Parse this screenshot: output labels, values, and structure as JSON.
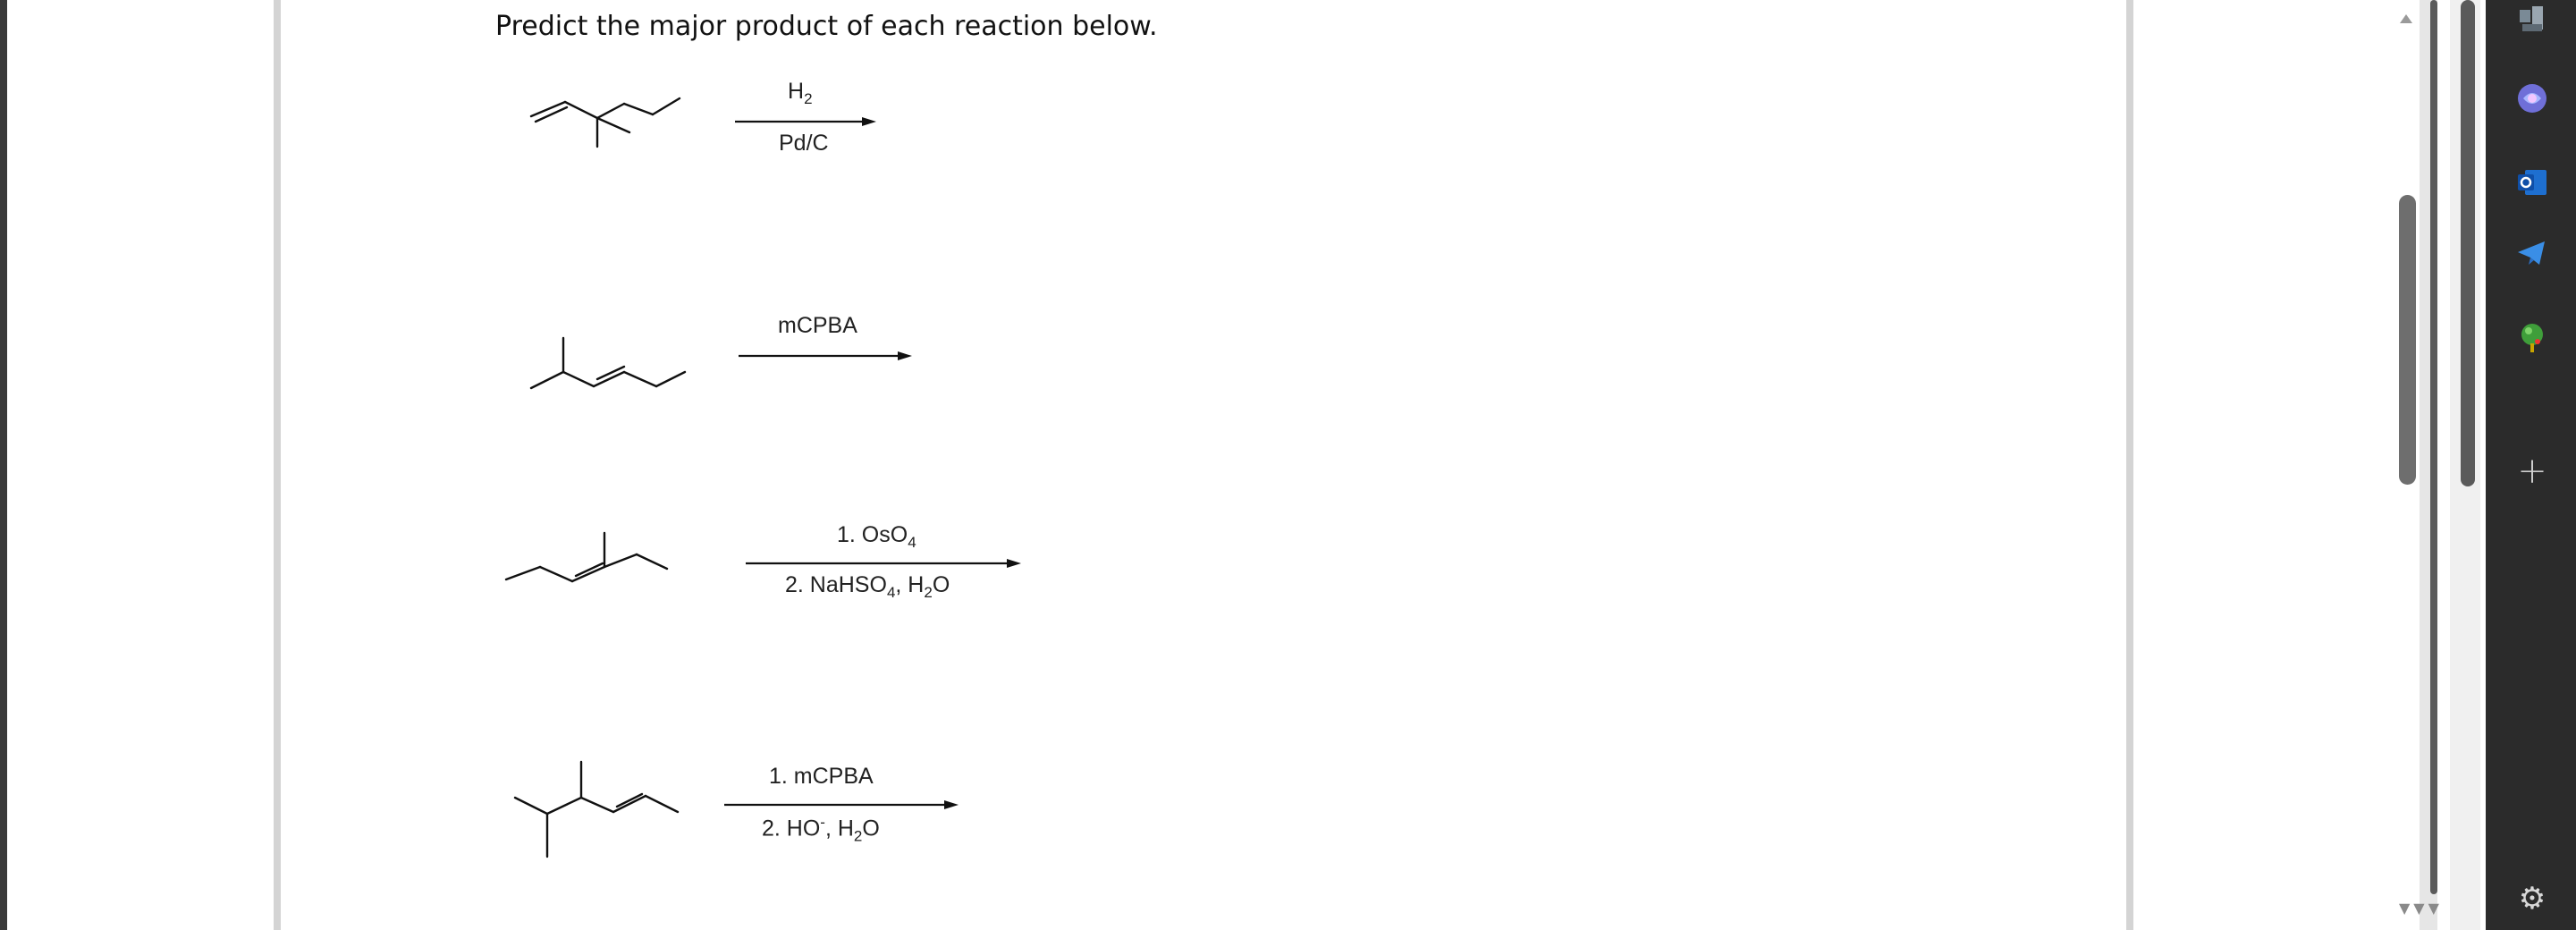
{
  "instruction": "Predict the major product of each reaction below.",
  "reactions": [
    {
      "id": 1,
      "above_arrow": {
        "text": "H",
        "sub": "2",
        "tail": ""
      },
      "below_arrow": {
        "text": "Pd/C"
      }
    },
    {
      "id": 2,
      "above_arrow": {
        "text": "mCPBA",
        "sub": "",
        "tail": ""
      },
      "below_arrow": {
        "text": ""
      }
    },
    {
      "id": 3,
      "above_arrow": {
        "text": "1. OsO",
        "sub": "4",
        "tail": ""
      },
      "below_arrow": {
        "text": "2. NaHSO",
        "sub": "4",
        "mid": ", H",
        "sub2": "2",
        "tail": "O"
      }
    },
    {
      "id": 4,
      "above_arrow": {
        "text": "1. mCPBA",
        "sub": "",
        "tail": ""
      },
      "below_arrow": {
        "text": "2. HO",
        "sup": "-",
        "mid": ", H",
        "sub2": "2",
        "tail": "O"
      }
    }
  ],
  "sidebar": {
    "icons": [
      "profile-icon",
      "copilot-icon",
      "outlook-icon",
      "telegram-icon",
      "games-icon",
      "add-icon",
      "settings-icon"
    ],
    "add_label": "+",
    "settings_label": "⚙"
  },
  "colors": {
    "sidebar_bg": "#2b2b2b",
    "page_border": "#d4d4d4",
    "text": "#111111"
  }
}
